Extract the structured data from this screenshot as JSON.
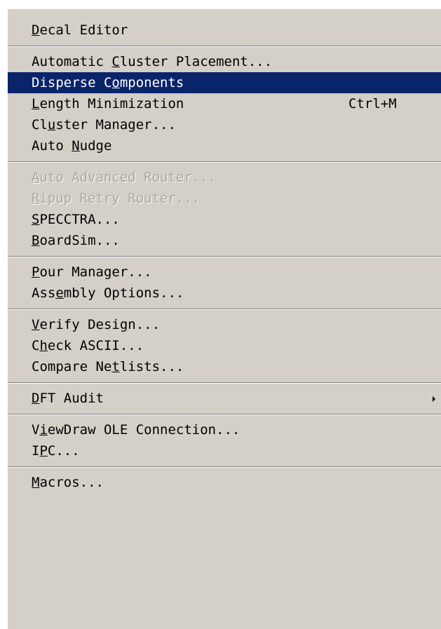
{
  "menu": {
    "items": [
      {
        "type": "item",
        "id": "decal-editor",
        "pre": "",
        "ul": "D",
        "post": "ecal Editor"
      },
      {
        "type": "sep"
      },
      {
        "type": "item",
        "id": "automatic-cluster-placement",
        "pre": "Automatic ",
        "ul": "C",
        "post": "luster Placement..."
      },
      {
        "type": "item",
        "id": "disperse-components",
        "pre": "Disperse C",
        "ul": "o",
        "post": "mponents",
        "selected": true
      },
      {
        "type": "item",
        "id": "length-minimization",
        "pre": "",
        "ul": "L",
        "post": "ength Minimization",
        "shortcut": "Ctrl+M"
      },
      {
        "type": "item",
        "id": "cluster-manager",
        "pre": "Cl",
        "ul": "u",
        "post": "ster Manager..."
      },
      {
        "type": "item",
        "id": "auto-nudge",
        "pre": "Auto ",
        "ul": "N",
        "post": "udge"
      },
      {
        "type": "sep"
      },
      {
        "type": "item",
        "id": "auto-advanced-router",
        "pre": "",
        "ul": "A",
        "post": "uto Advanced Router...",
        "disabled": true
      },
      {
        "type": "item",
        "id": "ripup-retry-router",
        "pre": "",
        "ul": "R",
        "post": "ipup Retry Router...",
        "disabled": true
      },
      {
        "type": "item",
        "id": "specctra",
        "pre": "",
        "ul": "S",
        "post": "PECCTRA..."
      },
      {
        "type": "item",
        "id": "boardsim",
        "pre": "",
        "ul": "B",
        "post": "oardSim..."
      },
      {
        "type": "sep"
      },
      {
        "type": "item",
        "id": "pour-manager",
        "pre": "",
        "ul": "P",
        "post": "our Manager..."
      },
      {
        "type": "item",
        "id": "assembly-options",
        "pre": "Ass",
        "ul": "e",
        "post": "mbly Options..."
      },
      {
        "type": "sep"
      },
      {
        "type": "item",
        "id": "verify-design",
        "pre": "",
        "ul": "V",
        "post": "erify Design..."
      },
      {
        "type": "item",
        "id": "check-ascii",
        "pre": "C",
        "ul": "h",
        "post": "eck ASCII..."
      },
      {
        "type": "item",
        "id": "compare-netlists",
        "pre": "Compare Ne",
        "ul": "t",
        "post": "lists..."
      },
      {
        "type": "sep"
      },
      {
        "type": "item",
        "id": "dft-audit",
        "pre": "",
        "ul": "D",
        "post": "FT Audit",
        "submenu": true
      },
      {
        "type": "sep"
      },
      {
        "type": "item",
        "id": "viewdraw-ole-connection",
        "pre": "V",
        "ul": "i",
        "post": "ewDraw OLE Connection..."
      },
      {
        "type": "item",
        "id": "ipc",
        "pre": "I",
        "ul": "P",
        "post": "C..."
      },
      {
        "type": "sep"
      },
      {
        "type": "item",
        "id": "macros",
        "pre": "",
        "ul": "M",
        "post": "acros..."
      }
    ]
  },
  "colors": {
    "menu_bg": "#d4d0c8",
    "highlight_bg": "#0a246a",
    "highlight_text": "#ffffff",
    "disabled_text": "#a9a6a0"
  },
  "icons": {
    "submenu_arrow": "submenu-arrow-icon"
  }
}
